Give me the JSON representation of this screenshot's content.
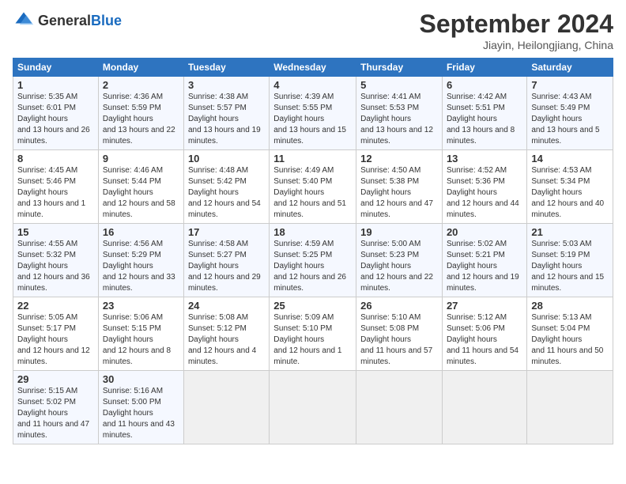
{
  "header": {
    "logo_general": "General",
    "logo_blue": "Blue",
    "title": "September 2024",
    "subtitle": "Jiayin, Heilongjiang, China"
  },
  "days_of_week": [
    "Sunday",
    "Monday",
    "Tuesday",
    "Wednesday",
    "Thursday",
    "Friday",
    "Saturday"
  ],
  "weeks": [
    [
      {
        "num": "1",
        "rise": "5:35 AM",
        "set": "6:01 PM",
        "daylight": "13 hours and 26 minutes."
      },
      {
        "num": "2",
        "rise": "4:36 AM",
        "set": "5:59 PM",
        "daylight": "13 hours and 22 minutes."
      },
      {
        "num": "3",
        "rise": "4:38 AM",
        "set": "5:57 PM",
        "daylight": "13 hours and 19 minutes."
      },
      {
        "num": "4",
        "rise": "4:39 AM",
        "set": "5:55 PM",
        "daylight": "13 hours and 15 minutes."
      },
      {
        "num": "5",
        "rise": "4:41 AM",
        "set": "5:53 PM",
        "daylight": "13 hours and 12 minutes."
      },
      {
        "num": "6",
        "rise": "4:42 AM",
        "set": "5:51 PM",
        "daylight": "13 hours and 8 minutes."
      },
      {
        "num": "7",
        "rise": "4:43 AM",
        "set": "5:49 PM",
        "daylight": "13 hours and 5 minutes."
      }
    ],
    [
      {
        "num": "8",
        "rise": "4:45 AM",
        "set": "5:46 PM",
        "daylight": "13 hours and 1 minute."
      },
      {
        "num": "9",
        "rise": "4:46 AM",
        "set": "5:44 PM",
        "daylight": "12 hours and 58 minutes."
      },
      {
        "num": "10",
        "rise": "4:48 AM",
        "set": "5:42 PM",
        "daylight": "12 hours and 54 minutes."
      },
      {
        "num": "11",
        "rise": "4:49 AM",
        "set": "5:40 PM",
        "daylight": "12 hours and 51 minutes."
      },
      {
        "num": "12",
        "rise": "4:50 AM",
        "set": "5:38 PM",
        "daylight": "12 hours and 47 minutes."
      },
      {
        "num": "13",
        "rise": "4:52 AM",
        "set": "5:36 PM",
        "daylight": "12 hours and 44 minutes."
      },
      {
        "num": "14",
        "rise": "4:53 AM",
        "set": "5:34 PM",
        "daylight": "12 hours and 40 minutes."
      }
    ],
    [
      {
        "num": "15",
        "rise": "4:55 AM",
        "set": "5:32 PM",
        "daylight": "12 hours and 36 minutes."
      },
      {
        "num": "16",
        "rise": "4:56 AM",
        "set": "5:29 PM",
        "daylight": "12 hours and 33 minutes."
      },
      {
        "num": "17",
        "rise": "4:58 AM",
        "set": "5:27 PM",
        "daylight": "12 hours and 29 minutes."
      },
      {
        "num": "18",
        "rise": "4:59 AM",
        "set": "5:25 PM",
        "daylight": "12 hours and 26 minutes."
      },
      {
        "num": "19",
        "rise": "5:00 AM",
        "set": "5:23 PM",
        "daylight": "12 hours and 22 minutes."
      },
      {
        "num": "20",
        "rise": "5:02 AM",
        "set": "5:21 PM",
        "daylight": "12 hours and 19 minutes."
      },
      {
        "num": "21",
        "rise": "5:03 AM",
        "set": "5:19 PM",
        "daylight": "12 hours and 15 minutes."
      }
    ],
    [
      {
        "num": "22",
        "rise": "5:05 AM",
        "set": "5:17 PM",
        "daylight": "12 hours and 12 minutes."
      },
      {
        "num": "23",
        "rise": "5:06 AM",
        "set": "5:15 PM",
        "daylight": "12 hours and 8 minutes."
      },
      {
        "num": "24",
        "rise": "5:08 AM",
        "set": "5:12 PM",
        "daylight": "12 hours and 4 minutes."
      },
      {
        "num": "25",
        "rise": "5:09 AM",
        "set": "5:10 PM",
        "daylight": "12 hours and 1 minute."
      },
      {
        "num": "26",
        "rise": "5:10 AM",
        "set": "5:08 PM",
        "daylight": "11 hours and 57 minutes."
      },
      {
        "num": "27",
        "rise": "5:12 AM",
        "set": "5:06 PM",
        "daylight": "11 hours and 54 minutes."
      },
      {
        "num": "28",
        "rise": "5:13 AM",
        "set": "5:04 PM",
        "daylight": "11 hours and 50 minutes."
      }
    ],
    [
      {
        "num": "29",
        "rise": "5:15 AM",
        "set": "5:02 PM",
        "daylight": "11 hours and 47 minutes."
      },
      {
        "num": "30",
        "rise": "5:16 AM",
        "set": "5:00 PM",
        "daylight": "11 hours and 43 minutes."
      },
      null,
      null,
      null,
      null,
      null
    ]
  ]
}
